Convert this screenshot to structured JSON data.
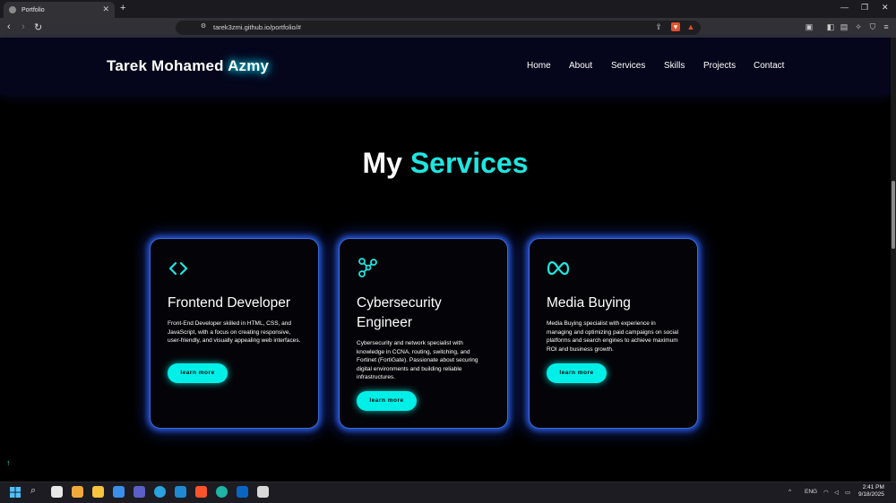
{
  "browser": {
    "tab_title": "Portfolio",
    "tab_close": "✕",
    "new_tab": "+",
    "minimize": "—",
    "restore": "❐",
    "close": "✕",
    "url": "tarek3zmi.github.io/portfolio/#"
  },
  "site": {
    "brand_main": "Tarek Mohamed",
    "brand_highlight": "Azmy",
    "nav": [
      "Home",
      "About",
      "Services",
      "Skills",
      "Projects",
      "Contact"
    ]
  },
  "section": {
    "title_main": "My",
    "title_highlight": "Services"
  },
  "cards": [
    {
      "icon": "code-icon",
      "title": "Frontend Developer",
      "description": "Front-End Developer skilled in HTML, CSS, and JavaScript, with a focus on creating responsive, user-friendly, and visually appealing web interfaces.",
      "button": "learn more"
    },
    {
      "icon": "network-icon",
      "title": "Cybersecurity Engineer",
      "description": "Cybersecurity and network specialist with knowledge in CCNA, routing, switching, and Fortinet (FortiGate). Passionate about securing digital environments and building reliable infrastructures.",
      "button": "learn more"
    },
    {
      "icon": "meta-icon",
      "title": "Media Buying",
      "description": "Media Buying specialist with experience in managing and optimizing paid campaigns on social platforms and search engines to achieve maximum ROI and business growth.",
      "button": "learn more"
    }
  ],
  "scroll_top_icon": "arrow-up-icon",
  "colors": {
    "accent": "#1ee6e0",
    "card_glow": "#3a6ad8",
    "header_bg": "#05051b"
  },
  "taskbar": {
    "language": "ENG",
    "time": "2:41 PM",
    "date": "9/18/2025"
  }
}
